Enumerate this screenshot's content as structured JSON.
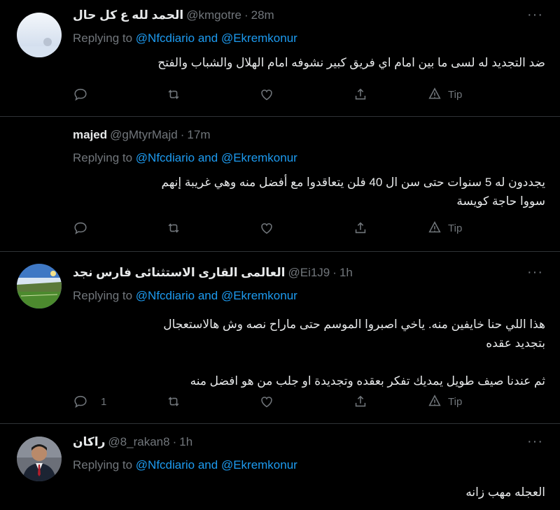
{
  "tweets": [
    {
      "name": "الحمد لله ع كل حال",
      "handle": "@kmgotre",
      "sep": "·",
      "time": "28m",
      "replying_prefix": "Replying to ",
      "mention1": "@Nfcdiario",
      "and": " and ",
      "mention2": "@Ekremkonur",
      "lines": [
        "ضد التجديد له لسى ما بين امام اي فريق كبير نشوفه امام الهلال والشباب والفتح"
      ],
      "reply_count": "",
      "tip_label": "Tip",
      "avatar": "pale-sky-avatar"
    },
    {
      "name": "majed",
      "handle": "@gMtyrMajd",
      "sep": "·",
      "time": "17m",
      "replying_prefix": "Replying to ",
      "mention1": "@Nfcdiario",
      "and": " and ",
      "mention2": "@Ekremkonur",
      "lines": [
        "يجددون له 5 سنوات حتى سن ال 40 فلن يتعاقدوا مع أفضل منه وهي غريبة إنهم",
        "سووا حاجة كويسة"
      ],
      "reply_count": "",
      "tip_label": "Tip"
    },
    {
      "name": "العالمى القارى الاستثنائى فارس نجد",
      "handle": "@Ei1J9",
      "sep": "·",
      "time": "1h",
      "replying_prefix": "Replying to ",
      "mention1": "@Nfcdiario",
      "and": " and ",
      "mention2": "@Ekremkonur",
      "lines": [
        "هذا اللي حنا خايفين منه. ياخي اصبروا الموسم حتى ماراح نصه وش هالاستعجال",
        "بتجديد عقده",
        "",
        "ثم عندنا صيف طويل يمديك تفكر بعقده وتجديدة او جلب من هو افضل منه"
      ],
      "reply_count": "1",
      "tip_label": "Tip",
      "avatar": "stadium-avatar"
    },
    {
      "name": "راكان",
      "handle": "@8_rakan8",
      "sep": "·",
      "time": "1h",
      "replying_prefix": "Replying to ",
      "mention1": "@Nfcdiario",
      "and": " and ",
      "mention2": "@Ekremkonur",
      "lines": [
        "العجله مهب زانه"
      ],
      "avatar": "person-avatar"
    }
  ],
  "colors": {
    "background": "#000000",
    "text": "#e7e9ea",
    "secondary": "#71767b",
    "accent": "#1d9bf0",
    "divider": "#2f3336"
  }
}
